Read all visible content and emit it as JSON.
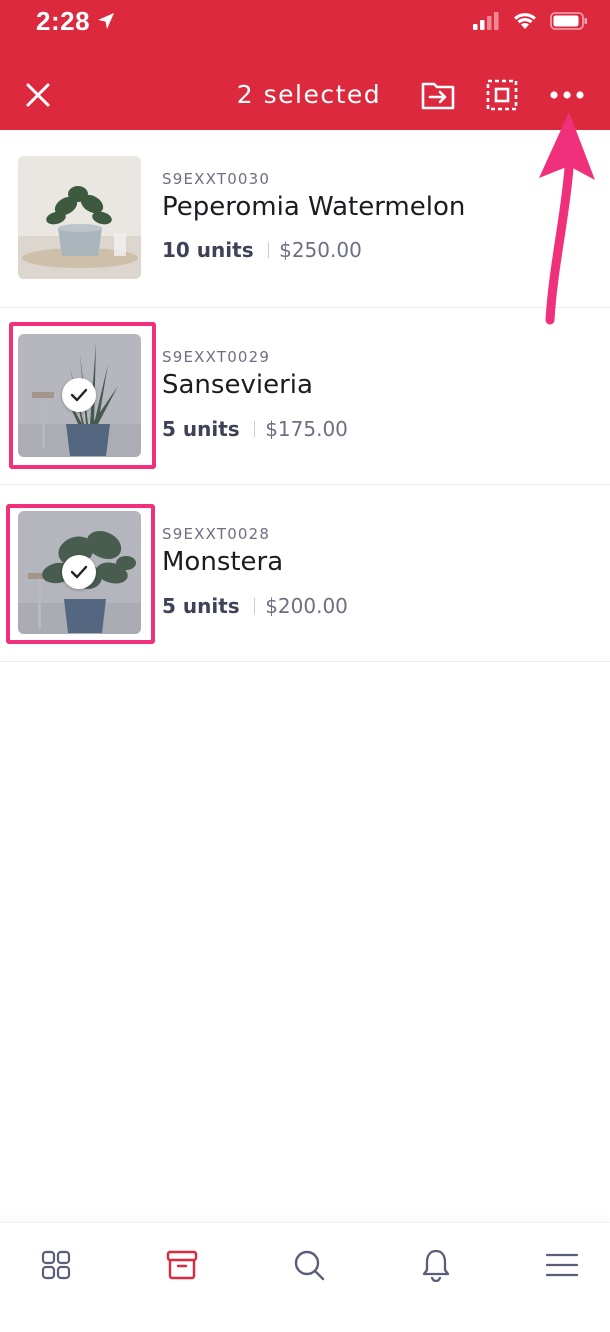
{
  "status_bar": {
    "time": "2:28"
  },
  "header": {
    "title": "2 selected",
    "background": "#dc293e",
    "buttons": [
      {
        "name": "close",
        "icon": "close-icon"
      },
      {
        "name": "move",
        "icon": "move-to-folder-icon"
      },
      {
        "name": "select-all",
        "icon": "select-all-icon"
      },
      {
        "name": "more",
        "icon": "more-dots-icon"
      }
    ]
  },
  "items": [
    {
      "sku": "S9EXXT0030",
      "name": "Peperomia Watermelon",
      "units": "10 units",
      "price": "$250.00",
      "selected": false
    },
    {
      "sku": "S9EXXT0029",
      "name": "Sansevieria",
      "units": "5 units",
      "price": "$175.00",
      "selected": true
    },
    {
      "sku": "S9EXXT0028",
      "name": "Monstera",
      "units": "5 units",
      "price": "$200.00",
      "selected": true
    }
  ],
  "bottom_nav": [
    {
      "name": "dashboard",
      "icon": "grid-icon",
      "active": false
    },
    {
      "name": "items",
      "icon": "box-icon",
      "active": true
    },
    {
      "name": "search",
      "icon": "search-icon",
      "active": false
    },
    {
      "name": "notifications",
      "icon": "bell-icon",
      "active": false
    },
    {
      "name": "menu",
      "icon": "menu-icon",
      "active": false
    }
  ],
  "colors": {
    "accent": "#dc293e",
    "highlight": "#f0307a",
    "nav_inactive": "#5b5e78"
  }
}
